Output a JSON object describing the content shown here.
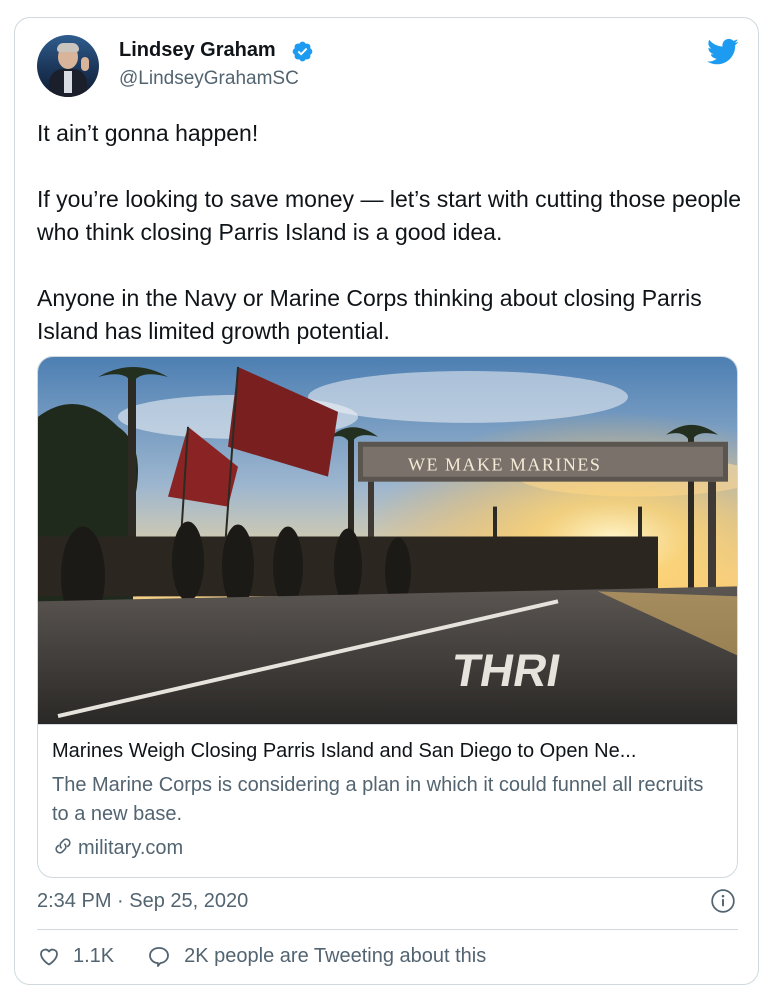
{
  "tweet": {
    "author": {
      "display_name": "Lindsey Graham",
      "handle": "@LindseyGrahamSC",
      "verified": true
    },
    "text": [
      "It ain’t gonna happen!",
      "If you’re looking to save money — let’s start with cutting those people who think closing Parris Island is a good idea.",
      "Anyone in the Navy or Marine Corps thinking about closing Parris Island has limited growth potential."
    ],
    "link_card": {
      "image_sign_text": "WE MAKE MARINES",
      "road_text": "THRI",
      "title": "Marines Weigh Closing Parris Island and San Diego to Open Ne...",
      "description": "The Marine Corps is considering a plan in which it could funnel all recruits to a new base.",
      "domain": "military.com"
    },
    "timestamp": "2:34 PM · Sep 25, 2020",
    "likes": "1.1K",
    "replies_label": "2K people are Tweeting about this"
  },
  "colors": {
    "twitter_blue": "#1d9bf0",
    "text_primary": "#0f1419",
    "text_secondary": "#536471",
    "border": "#cfd9de"
  },
  "icons": [
    "verified-badge-icon",
    "twitter-bird-icon",
    "link-icon",
    "info-icon",
    "heart-icon",
    "reply-bubble-icon"
  ]
}
